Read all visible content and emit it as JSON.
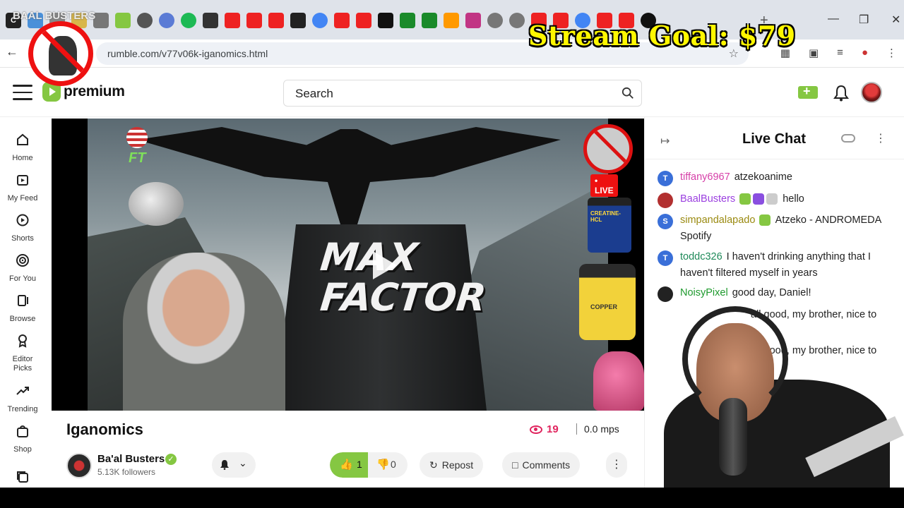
{
  "browser": {
    "url": "rumble.com/v77v06k-iganomics.html",
    "new_tab_label": "+"
  },
  "overlay": {
    "stream_goal": "Stream Goal: $79",
    "watermark": "BAAL BUSTERS"
  },
  "header": {
    "logo_text": "premium",
    "search_placeholder": "Search"
  },
  "nav": {
    "items": [
      {
        "label": "Home",
        "icon": "home-icon"
      },
      {
        "label": "My Feed",
        "icon": "feed-icon"
      },
      {
        "label": "Shorts",
        "icon": "shorts-icon"
      },
      {
        "label": "For You",
        "icon": "target-icon"
      },
      {
        "label": "Browse",
        "icon": "browse-icon"
      },
      {
        "label": "Editor Picks",
        "icon": "award-icon"
      },
      {
        "label": "Trending",
        "icon": "trending-icon"
      },
      {
        "label": "Shop",
        "icon": "shop-icon"
      }
    ]
  },
  "video": {
    "thumb_title_line1": "MAX",
    "thumb_title_line2": "FACTOR",
    "live_badge": "• LIVE",
    "bottle1_text": "CREATINE-HCL",
    "bottle2_text": "COPPER"
  },
  "details": {
    "title": "Iganomics",
    "views": "19",
    "mps": "0.0 mps",
    "channel_name": "Ba'al Busters",
    "followers": "5.13K followers",
    "likes": "1",
    "dislikes": "0",
    "repost_label": "Repost",
    "comments_label": "Comments"
  },
  "chat": {
    "title": "Live Chat",
    "messages": [
      {
        "initial": "T",
        "user": "tiffany6967",
        "color": "#d63fa8",
        "text": "atzekoanime",
        "av_color": "#3a6fd8"
      },
      {
        "initial": "",
        "user": "BaalBusters",
        "color": "#9b3fe0",
        "text": "hello",
        "av_color": "#b23030"
      },
      {
        "initial": "S",
        "user": "simpandalapado",
        "color": "#9a8a10",
        "text": "Atzeko - ANDROMEDA Spotify",
        "av_color": "#3a6fd8"
      },
      {
        "initial": "T",
        "user": "toddc326",
        "color": "#1f8a5a",
        "text": "I haven't drinking anything that I haven't filtered myself in years",
        "av_color": "#3a6fd8"
      },
      {
        "initial": "",
        "user": "NoisyPixel",
        "color": "#1f9a2e",
        "text": "good day, Daniel!",
        "av_color": "#222"
      },
      {
        "initial": "",
        "user": "",
        "color": "#222",
        "text": "all good, my brother, nice to",
        "av_color": "#222"
      },
      {
        "initial": "",
        "user": "",
        "color": "#222",
        "text": "all good, my brother, nice to",
        "av_color": "#222"
      }
    ]
  },
  "colors": {
    "brand_green": "#85c742",
    "views_pink": "#e0245e",
    "goal_yellow": "#fff700"
  }
}
